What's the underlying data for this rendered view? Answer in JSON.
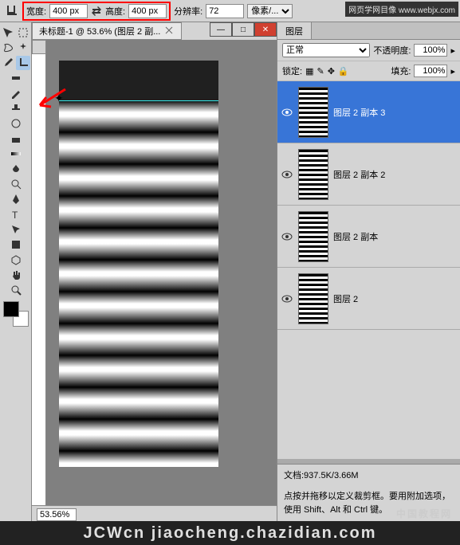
{
  "topbar": {
    "width_label": "宽度:",
    "width_value": "400 px",
    "height_label": "高度:",
    "height_value": "400 px",
    "resolution_label": "分辨率:",
    "resolution_value": "72",
    "units_label": "像素/..."
  },
  "watermark_top": "网页学网目像  www.webjx.com",
  "tab": {
    "title": "未标题-1 @ 53.6% (图层 2 副..."
  },
  "status": {
    "zoom": "53.56%"
  },
  "layers_panel": {
    "tab_label": "图层",
    "blend_mode": "正常",
    "opacity_label": "不透明度:",
    "opacity_value": "100%",
    "lock_label": "锁定:",
    "fill_label": "填充:",
    "fill_value": "100%",
    "items": [
      {
        "name": "图层 2 副本 3"
      },
      {
        "name": "图层 2 副本 2"
      },
      {
        "name": "图层 2 副本"
      },
      {
        "name": "图层 2"
      }
    ]
  },
  "info": {
    "doc_size": "文档:937.5K/3.66M",
    "hint": "点按并拖移以定义裁剪框。要用附加选项，使用 Shift、Alt 和 Ctrl 键。"
  },
  "bottom_watermark": {
    "cn": "中国教程网",
    "en": "JCWcn  jiaocheng.chazidian.com"
  }
}
